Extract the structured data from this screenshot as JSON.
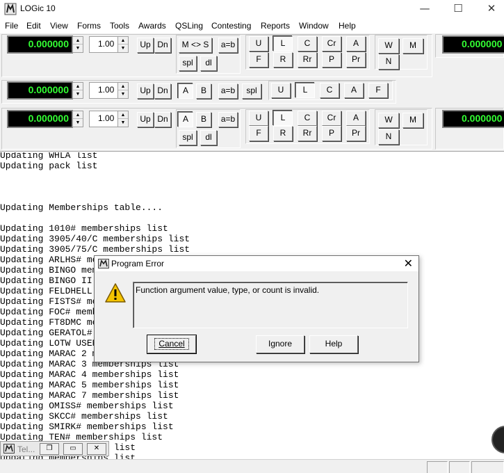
{
  "window": {
    "title": "LOGic 10",
    "minimize": "—",
    "maximize": "☐",
    "close": "✕"
  },
  "menu": [
    "File",
    "Edit",
    "View",
    "Forms",
    "Tools",
    "Awards",
    "QSLing",
    "Contesting",
    "Reports",
    "Window",
    "Help"
  ],
  "radio1": {
    "freq": "0.000000",
    "step": "1.00",
    "up": "Up",
    "dn": "Dn",
    "mode_swap": "M <> S",
    "a_eq_b": "a=b",
    "spl": "spl",
    "dl": "dl",
    "filters_row1": [
      "U",
      "L",
      "C",
      "Cr",
      "A"
    ],
    "filters_row2": [
      "F",
      "R",
      "Rr",
      "P",
      "Pr"
    ],
    "w": "W",
    "m": "M",
    "n": "N",
    "freq_right": "0.000000"
  },
  "radio2": {
    "freq": "0.000000",
    "step": "1.00",
    "up": "Up",
    "dn": "Dn",
    "a": "A",
    "b": "B",
    "a_eq_b": "a=b",
    "spl": "spl",
    "filters": [
      "U",
      "L",
      "C",
      "A",
      "F"
    ]
  },
  "radio3": {
    "freq": "0.000000",
    "step": "1.00",
    "up": "Up",
    "dn": "Dn",
    "a": "A",
    "b": "B",
    "a_eq_b": "a=b",
    "spl": "spl",
    "dl": "dl",
    "filters_row1": [
      "U",
      "L",
      "C",
      "Cr",
      "A"
    ],
    "filters_row2": [
      "F",
      "R",
      "Rr",
      "P",
      "Pr"
    ],
    "w": "W",
    "m": "M",
    "n": "N",
    "freq_right": "0.000000"
  },
  "log_lines": [
    "Updating WHLA list",
    "Updating pack list",
    "",
    "",
    "",
    "Updating Memberships table....",
    "",
    "Updating 1010# memberships list",
    "Updating 3905/40/C memberships list",
    "Updating 3905/75/C memberships list",
    "Updating ARLHS# memberships list",
    "Updating BINGO memberships list",
    "Updating BINGO II memberships list",
    "Updating FELDHELL memberships list",
    "Updating FISTS# memberships list",
    "Updating FOC# memberships list",
    "Updating FT8DMC memberships list",
    "Updating GERATOL# memberships list",
    "Updating LOTW USERS memberships list",
    "Updating MARAC 2 memberships list",
    "Updating MARAC 3 memberships list",
    "Updating MARAC 4 memberships list",
    "Updating MARAC 5 memberships list",
    "Updating MARAC 7 memberships list",
    "Updating OMISS# memberships list",
    "Updating SKCC# memberships list",
    "Updating SMIRK# memberships list",
    "Updating TEN# memberships list",
    "Updating memberships list",
    "Updating memberships list"
  ],
  "dialog": {
    "title": "Program Error",
    "message": "Function argument value, type, or count is invalid.",
    "cancel": "Cancel",
    "ignore": "Ignore",
    "help": "Help",
    "close": "✕"
  },
  "mini_window": {
    "label": "Tel..."
  }
}
